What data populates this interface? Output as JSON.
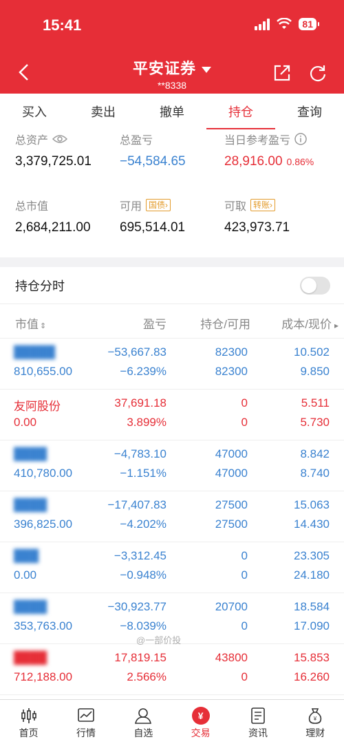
{
  "status": {
    "time": "15:41",
    "battery": "81"
  },
  "header": {
    "title": "平安证券",
    "account": "**8338"
  },
  "tabs": [
    {
      "label": "买入"
    },
    {
      "label": "卖出"
    },
    {
      "label": "撤单"
    },
    {
      "label": "持仓"
    },
    {
      "label": "查询"
    }
  ],
  "summary": {
    "total_assets_label": "总资产",
    "total_assets": "3,379,725.01",
    "total_pnl_label": "总盈亏",
    "total_pnl": "−54,584.65",
    "today_pnl_label": "当日参考盈亏",
    "today_pnl": "28,916.00",
    "today_pnl_pct": "0.86%",
    "market_value_label": "总市值",
    "market_value": "2,684,211.00",
    "available_label": "可用",
    "available": "695,514.01",
    "guozhai_btn": "国债",
    "withdrawable_label": "可取",
    "withdrawable": "423,973.71",
    "transfer_btn": "转账"
  },
  "holdings": {
    "toggle_label": "持仓分时",
    "columns": [
      "市值",
      "盈亏",
      "持仓/可用",
      "成本/现价"
    ],
    "watermark": "@一部价投",
    "rows": [
      {
        "name": "█████",
        "market_value": "810,655.00",
        "pnl": "−53,667.83",
        "pnl_pct": "−6.239%",
        "holding": "82300",
        "available": "82300",
        "cost": "10.502",
        "price": "9.850",
        "dir": "down"
      },
      {
        "name": "友阿股份",
        "market_value": "0.00",
        "pnl": "37,691.18",
        "pnl_pct": "3.899%",
        "holding": "0",
        "available": "0",
        "cost": "5.511",
        "price": "5.730",
        "dir": "up"
      },
      {
        "name": "████",
        "market_value": "410,780.00",
        "pnl": "−4,783.10",
        "pnl_pct": "−1.151%",
        "holding": "47000",
        "available": "47000",
        "cost": "8.842",
        "price": "8.740",
        "dir": "down"
      },
      {
        "name": "████",
        "market_value": "396,825.00",
        "pnl": "−17,407.83",
        "pnl_pct": "−4.202%",
        "holding": "27500",
        "available": "27500",
        "cost": "15.063",
        "price": "14.430",
        "dir": "down"
      },
      {
        "name": "███",
        "market_value": "0.00",
        "pnl": "−3,312.45",
        "pnl_pct": "−0.948%",
        "holding": "0",
        "available": "0",
        "cost": "23.305",
        "price": "24.180",
        "dir": "down"
      },
      {
        "name": "████",
        "market_value": "353,763.00",
        "pnl": "−30,923.77",
        "pnl_pct": "−8.039%",
        "holding": "20700",
        "available": "0",
        "cost": "18.584",
        "price": "17.090",
        "dir": "down"
      },
      {
        "name": "████",
        "market_value": "712,188.00",
        "pnl": "17,819.15",
        "pnl_pct": "2.566%",
        "holding": "43800",
        "available": "0",
        "cost": "15.853",
        "price": "16.260",
        "dir": "up"
      }
    ]
  },
  "nav": [
    {
      "label": "首页",
      "icon": "candlestick-icon"
    },
    {
      "label": "行情",
      "icon": "chart-icon"
    },
    {
      "label": "自选",
      "icon": "person-icon"
    },
    {
      "label": "交易",
      "icon": "yen-icon"
    },
    {
      "label": "资讯",
      "icon": "document-icon"
    },
    {
      "label": "理财",
      "icon": "money-bag-icon"
    }
  ],
  "colors": {
    "brand": "#e62e37",
    "negative": "#3a82d0",
    "warning": "#e39b2b"
  }
}
